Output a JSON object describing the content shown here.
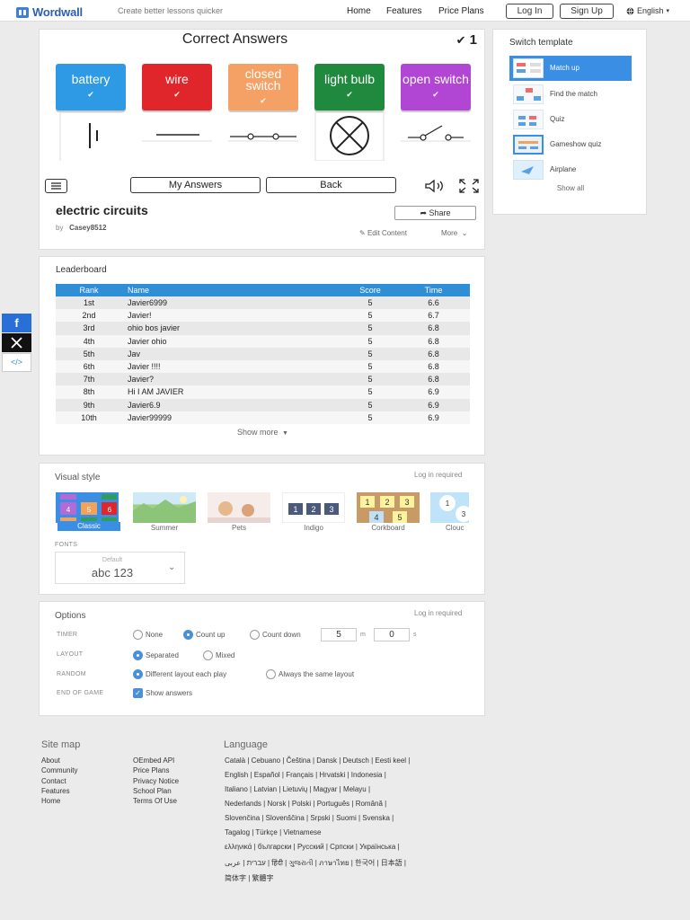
{
  "header": {
    "logo": "Wordwall",
    "tagline": "Create better lessons quicker",
    "nav": [
      "Home",
      "Features",
      "Price Plans"
    ],
    "login": "Log In",
    "signup": "Sign Up",
    "language": "English"
  },
  "game": {
    "title": "Correct Answers",
    "score": "1",
    "tiles": [
      {
        "label": "battery",
        "color": "#2e9ae6"
      },
      {
        "label": "wire",
        "color": "#e0252b"
      },
      {
        "label": "closed switch",
        "color": "#f5a064"
      },
      {
        "label": "light bulb",
        "color": "#1f8a3e"
      },
      {
        "label": "open switch",
        "color": "#b246d4"
      }
    ],
    "check_icon": "check-icon",
    "my_answers": "My Answers",
    "back": "Back"
  },
  "activity": {
    "title": "electric circuits",
    "by_label": "by",
    "author": "Casey8512",
    "share": "Share",
    "edit": "Edit Content",
    "more": "More"
  },
  "switch_template": {
    "title": "Switch template",
    "items": [
      "Match up",
      "Find the match",
      "Quiz",
      "Gameshow quiz",
      "Airplane"
    ],
    "show_all": "Show all"
  },
  "leaderboard": {
    "title": "Leaderboard",
    "columns": [
      "Rank",
      "Name",
      "Score",
      "Time"
    ],
    "rows": [
      [
        "1st",
        "Javier6999",
        "5",
        "6.6"
      ],
      [
        "2nd",
        "Javier!",
        "5",
        "6.7"
      ],
      [
        "3rd",
        "ohio bos javier",
        "5",
        "6.8"
      ],
      [
        "4th",
        "Javier ohio",
        "5",
        "6.8"
      ],
      [
        "5th",
        "Jav",
        "5",
        "6.8"
      ],
      [
        "6th",
        "Javier !!!!",
        "5",
        "6.8"
      ],
      [
        "7th",
        "Javier?",
        "5",
        "6.8"
      ],
      [
        "8th",
        "Hi I AM JAVIER",
        "5",
        "6.9"
      ],
      [
        "9th",
        "Javier6.9",
        "5",
        "6.9"
      ],
      [
        "10th",
        "Javier99999",
        "5",
        "6.9"
      ]
    ],
    "show_more": "Show more"
  },
  "visual_style": {
    "title": "Visual style",
    "login_required": "Log in required",
    "styles": [
      "Classic",
      "Summer",
      "Pets",
      "Indigo",
      "Corkboard",
      "Clouc"
    ],
    "fonts_label": "FONTS",
    "font_default": "Default",
    "font_sample": "abc 123"
  },
  "options": {
    "title": "Options",
    "login_required": "Log in required",
    "timer_label": "TIMER",
    "timer_none": "None",
    "timer_up": "Count up",
    "timer_down": "Count down",
    "minutes": "5",
    "min_unit": "m",
    "seconds": "0",
    "sec_unit": "s",
    "layout_label": "LAYOUT",
    "layout_sep": "Separated",
    "layout_mixed": "Mixed",
    "random_label": "RANDOM",
    "random_diff": "Different layout each play",
    "random_same": "Always the same layout",
    "end_label": "END OF GAME",
    "end_show": "Show answers"
  },
  "footer": {
    "sitemap_title": "Site map",
    "col1": [
      "About",
      "Community",
      "Contact",
      "Features",
      "Home"
    ],
    "col2": [
      "OEmbed API",
      "Price Plans",
      "Privacy Notice",
      "School Plan",
      "Terms Of Use"
    ],
    "language_title": "Language",
    "lang_lines": [
      "Català  |  Cebuano  |  Čeština  |  Dansk  |  Deutsch  |  Eesti keel  |",
      "English  |  Español  |  Français  |  Hrvatski  |  Indonesia  |",
      "Italiano  |  Latvian  |  Lietuvių  |  Magyar  |  Melayu  |",
      "Nederlands  |  Norsk  |  Polski  |  Português  |  Română  |",
      "Slovenčina  |  Slovenščina  |  Srpski  |  Suomi  |  Svenska  |",
      "Tagalog  |  Türkçe  |  Vietnamese",
      "ελληνικά  |  български  |  Русский  |  Српски  |  Українська  |",
      "עברית  |  عربى  |  हिंदी  |  ગુજરાતી  |  ภาษาไทย  |  한국어  |  日本語  |",
      "简体字  |  繁體字"
    ]
  },
  "social": {
    "facebook": "f",
    "embed": "</>"
  }
}
